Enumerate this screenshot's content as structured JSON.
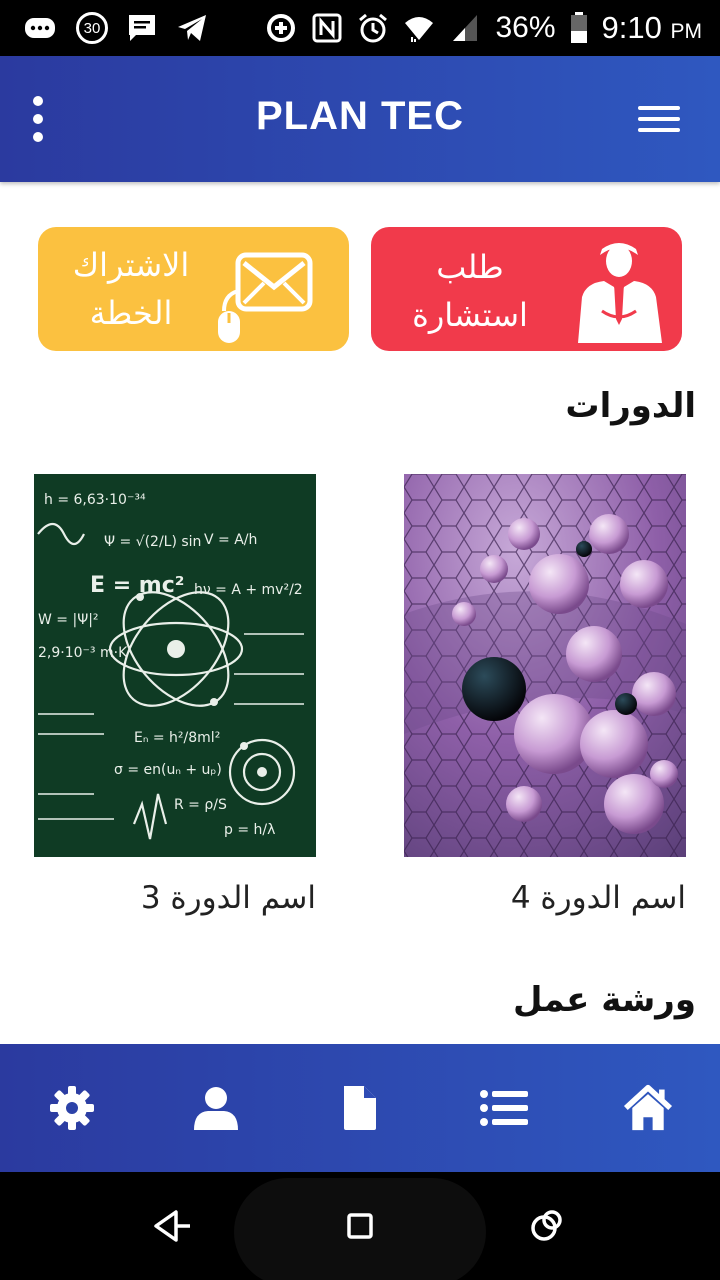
{
  "status_bar": {
    "notification_count": "30",
    "battery": "36%",
    "time": "9:10",
    "time_suffix": "PM",
    "icons_left": [
      "messenger-icon",
      "notification-badge-icon",
      "message-icon",
      "telegram-icon"
    ],
    "icons_right": [
      "data-saver-icon",
      "nfc-icon",
      "alarm-icon",
      "wifi-icon",
      "signal-icon",
      "battery-icon"
    ]
  },
  "app_bar": {
    "title": "PLAN TEC",
    "icons": [
      "overflow-menu-icon",
      "hamburger-menu-icon"
    ]
  },
  "actions": {
    "consultation": {
      "line1": "طلب",
      "line2": "استشارة",
      "color": "#f13a4b",
      "icon": "businessman-icon"
    },
    "subscribe": {
      "line1": "الاشتراك",
      "line2": "الخطة",
      "color": "#fbc140",
      "icon": "email-mouse-icon"
    }
  },
  "sections": {
    "courses": "الدورات",
    "workshop": "ورشة عمل"
  },
  "courses": [
    {
      "name": "اسم الدورة 4",
      "image": "purple-spheres-image"
    },
    {
      "name": "اسم الدورة 3",
      "image": "physics-chalkboard-image"
    }
  ],
  "chalkboard": {
    "equation": "E = mc²",
    "formulas": [
      "h = 6,63·10⁻³⁴",
      "V = A/h",
      "hν = A + mv²/2",
      "Eₙ = h²/8ml²",
      "σ = en(uₙ + uₚ)",
      "R = ρ/S",
      "p = h/λ",
      "W = |Ψ|²",
      "2,9·10⁻³ m·K",
      "Ψ = √(2/L) sin"
    ]
  },
  "bottom_nav": [
    "gear-icon",
    "user-icon",
    "document-icon",
    "list-icon",
    "home-icon"
  ],
  "system_nav": [
    "back-icon",
    "home-square-icon",
    "recents-icon"
  ],
  "colors": {
    "primary_start": "#2b3a9f",
    "primary_end": "#2f58c0",
    "red": "#f13a4b",
    "yellow": "#fbc140"
  }
}
